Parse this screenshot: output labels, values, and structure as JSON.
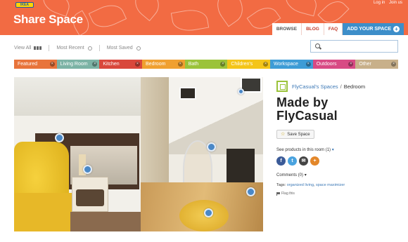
{
  "brand": {
    "logo": "IKEA",
    "title": "Share Space"
  },
  "top_links": {
    "login": "Log in",
    "join": "Join us"
  },
  "nav": {
    "tabs": [
      {
        "label": "BROWSE"
      },
      {
        "label": "BLOG"
      },
      {
        "label": "FAQ"
      }
    ],
    "add_label": "ADD YOUR SPACE"
  },
  "filters": {
    "view_all": "View All",
    "most_recent": "Most Recent",
    "most_saved": "Most Saved"
  },
  "search": {
    "placeholder": ""
  },
  "categories": [
    {
      "label": "Featured",
      "color": "#e8743b"
    },
    {
      "label": "Living Room",
      "color": "#7cb3a5"
    },
    {
      "label": "Kitchen",
      "color": "#d9473b"
    },
    {
      "label": "Bedroom",
      "color": "#f0a030"
    },
    {
      "label": "Bath",
      "color": "#9bc33a"
    },
    {
      "label": "Children's",
      "color": "#f4c518"
    },
    {
      "label": "Workspace",
      "color": "#3d9cd6"
    },
    {
      "label": "Outdoors",
      "color": "#d84a84"
    },
    {
      "label": "Other",
      "color": "#c8b08a"
    }
  ],
  "panel": {
    "owner_link": "FlyCasual's Spaces",
    "separator": "/",
    "room": "Bedroom",
    "title_line1": "Made by",
    "title_line2": "FlyCasual",
    "save_label": "Save Space",
    "products_label": "See products in this room (1)",
    "share_icons": [
      "f",
      "t",
      "✉",
      "+"
    ],
    "comments_label": "Comments (0)",
    "tags_prefix": "Tags:",
    "tags": [
      "organized living",
      "space maximizer"
    ],
    "flag_label": "Flag this"
  }
}
